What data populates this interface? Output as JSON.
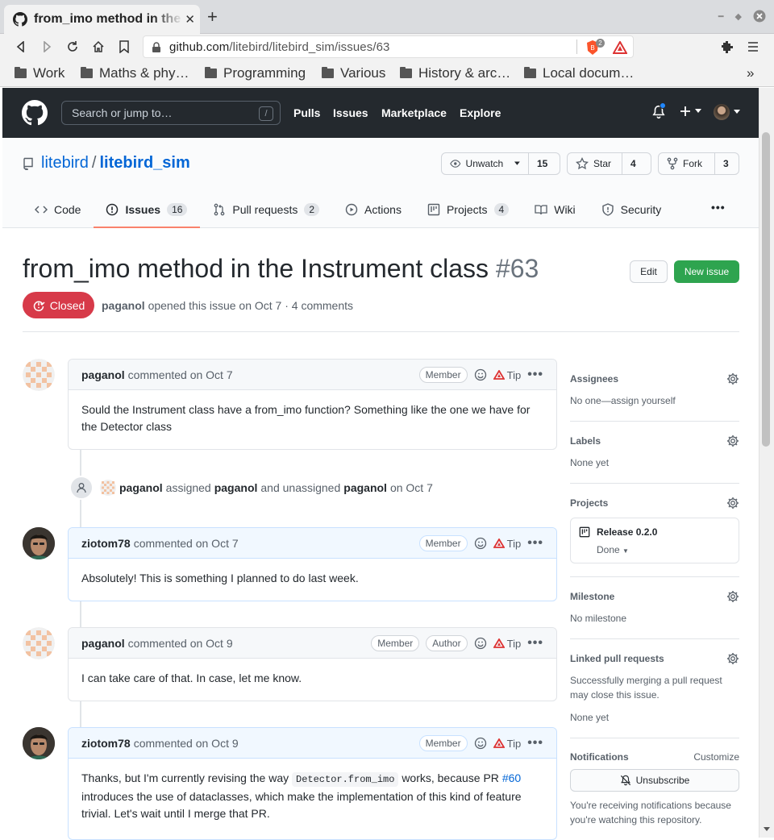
{
  "browser": {
    "tab_title": "from_imo method in the Instrument class",
    "url_domain": "github.com",
    "url_path": "/litebird/litebird_sim/issues/63",
    "brave_count": "2",
    "bookmarks": [
      "Work",
      "Maths & phy…",
      "Programming",
      "Various",
      "History & arc…",
      "Local docum…"
    ],
    "more_bookmarks": "»"
  },
  "github_header": {
    "search_placeholder": "Search or jump to…",
    "search_key": "/",
    "nav": [
      "Pulls",
      "Issues",
      "Marketplace",
      "Explore"
    ]
  },
  "repo": {
    "owner": "litebird",
    "separator": "/",
    "name": "litebird_sim",
    "unwatch_label": "Unwatch",
    "unwatch_count": "15",
    "star_label": "Star",
    "star_count": "4",
    "fork_label": "Fork",
    "fork_count": "3",
    "tabs": [
      {
        "label": "Code",
        "count": null
      },
      {
        "label": "Issues",
        "count": "16"
      },
      {
        "label": "Pull requests",
        "count": "2"
      },
      {
        "label": "Actions",
        "count": null
      },
      {
        "label": "Projects",
        "count": "4"
      },
      {
        "label": "Wiki",
        "count": null
      },
      {
        "label": "Security",
        "count": null
      }
    ],
    "more_tabs": "•••"
  },
  "issue": {
    "title": "from_imo method in the Instrument class",
    "number": "#63",
    "edit_label": "Edit",
    "new_issue_label": "New issue",
    "state": "Closed",
    "author": "paganol",
    "meta_text": "opened this issue on Oct 7 · 4 comments"
  },
  "comments": [
    {
      "author": "paganol",
      "action": "commented on Oct 7",
      "badges": [
        "Member"
      ],
      "body": "Sould the Instrument class have a from_imo function? Something like the one we have for the Detector class"
    },
    {
      "author": "ziotom78",
      "action": "commented on Oct 7",
      "badges": [
        "Member"
      ],
      "body": "Absolutely! This is something I planned to do last week."
    },
    {
      "author": "paganol",
      "action": "commented on Oct 9",
      "badges": [
        "Member",
        "Author"
      ],
      "body": "I can take care of that. In case, let me know."
    },
    {
      "author": "ziotom78",
      "action": "commented on Oct 9",
      "badges": [
        "Member"
      ],
      "body_before": "Thanks, but I'm currently revising the way",
      "body_code": "Detector.from_imo",
      "body_middle": "works, because PR",
      "body_link": "#60",
      "body_after": "introduces the use of dataclasses, which make the implementation of this kind of feature trivial. Let's wait until I merge that PR."
    }
  ],
  "tip_label": "Tip",
  "more_label": "•••",
  "event": {
    "actor": "paganol",
    "verb1": "assigned",
    "target1": "paganol",
    "verb2": "and unassigned",
    "target2": "paganol",
    "date": "on Oct 7"
  },
  "sidebar": {
    "assignees": {
      "label": "Assignees",
      "value": "No one—assign yourself"
    },
    "labels": {
      "label": "Labels",
      "value": "None yet"
    },
    "projects": {
      "label": "Projects",
      "project_name": "Release 0.2.0",
      "status": "Done"
    },
    "milestone": {
      "label": "Milestone",
      "value": "No milestone"
    },
    "linked_prs": {
      "label": "Linked pull requests",
      "value": "Successfully merging a pull request may close this issue.",
      "value2": "None yet"
    },
    "notifications": {
      "label": "Notifications",
      "customize": "Customize",
      "unsubscribe": "Unsubscribe",
      "note": "You're receiving notifications because you're watching this repository."
    }
  },
  "colors": {
    "closed": "#d73a49",
    "new_issue": "#2ea44f",
    "link": "#0366d6",
    "header_bg": "#24292e"
  }
}
